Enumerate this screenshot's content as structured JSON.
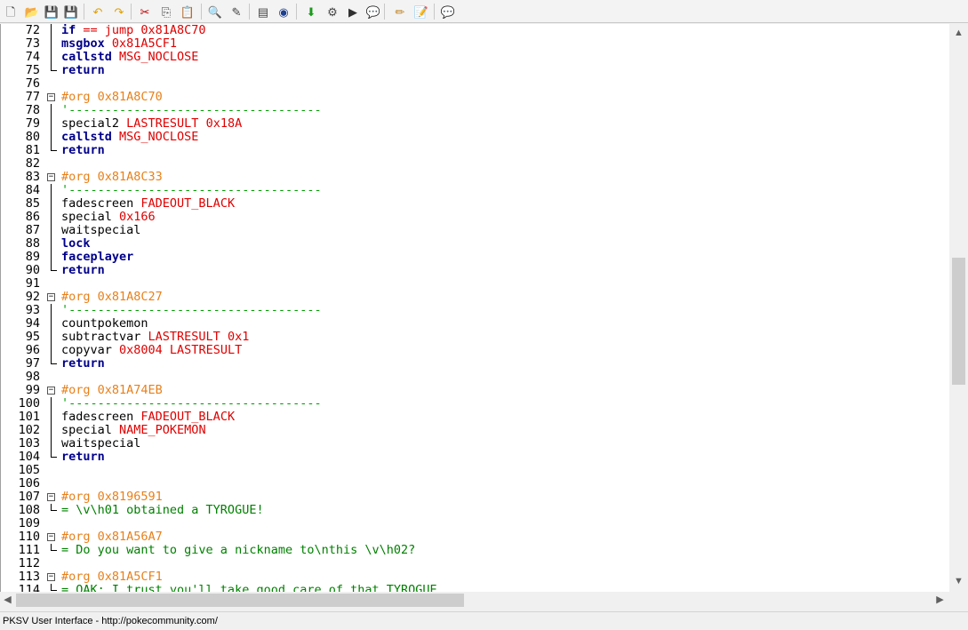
{
  "toolbar": {
    "buttons": [
      {
        "name": "new-file-icon",
        "glyph": "🗋"
      },
      {
        "name": "open-file-icon",
        "glyph": "📂"
      },
      {
        "name": "save-icon",
        "glyph": "💾"
      },
      {
        "name": "save-as-icon",
        "glyph": "💾"
      },
      {
        "name": "undo-icon",
        "glyph": "↶"
      },
      {
        "name": "redo-icon",
        "glyph": "↷"
      },
      {
        "name": "cut-icon",
        "glyph": "✂"
      },
      {
        "name": "copy-icon",
        "glyph": "⎘"
      },
      {
        "name": "paste-icon",
        "glyph": "📋"
      },
      {
        "name": "find-icon",
        "glyph": "🔍"
      },
      {
        "name": "replace-icon",
        "glyph": "✎"
      },
      {
        "name": "rom-document-icon",
        "glyph": "▤"
      },
      {
        "name": "globe-icon",
        "glyph": "◉"
      },
      {
        "name": "compile-icon",
        "glyph": "⬇"
      },
      {
        "name": "settings-icon",
        "glyph": "⚙"
      },
      {
        "name": "run-icon",
        "glyph": "▶"
      },
      {
        "name": "chat-icon",
        "glyph": "💬"
      },
      {
        "name": "edit-pencil-icon",
        "glyph": "✏"
      },
      {
        "name": "notes-icon",
        "glyph": "📝"
      },
      {
        "name": "help-chat-icon",
        "glyph": "💬"
      }
    ]
  },
  "editor": {
    "lines": [
      {
        "n": "72",
        "parts": [
          [
            "kw",
            "if"
          ],
          [
            "arg",
            " == jump 0x81A8C70"
          ]
        ],
        "gutter": "bar"
      },
      {
        "n": "73",
        "parts": [
          [
            "kw",
            "msgbox"
          ],
          [
            "arg",
            " 0x81A5CF1"
          ]
        ],
        "gutter": "bar"
      },
      {
        "n": "74",
        "parts": [
          [
            "kw",
            "callstd"
          ],
          [
            "arg",
            " MSG_NOCLOSE"
          ]
        ],
        "gutter": "bar"
      },
      {
        "n": "75",
        "parts": [
          [
            "kw",
            "return"
          ]
        ],
        "gutter": "end"
      },
      {
        "n": "76",
        "parts": [],
        "gutter": ""
      },
      {
        "n": "77",
        "parts": [
          [
            "org",
            "#org 0x81A8C70"
          ]
        ],
        "gutter": "fold"
      },
      {
        "n": "78",
        "parts": [
          [
            "cmt",
            "'-----------------------------------"
          ]
        ],
        "gutter": "bar"
      },
      {
        "n": "79",
        "parts": [
          [
            "cmd",
            "special2"
          ],
          [
            "arg",
            " LASTRESULT 0x18A"
          ]
        ],
        "gutter": "bar"
      },
      {
        "n": "80",
        "parts": [
          [
            "kw",
            "callstd"
          ],
          [
            "arg",
            " MSG_NOCLOSE"
          ]
        ],
        "gutter": "bar"
      },
      {
        "n": "81",
        "parts": [
          [
            "kw",
            "return"
          ]
        ],
        "gutter": "end"
      },
      {
        "n": "82",
        "parts": [],
        "gutter": ""
      },
      {
        "n": "83",
        "parts": [
          [
            "org",
            "#org 0x81A8C33"
          ]
        ],
        "gutter": "fold"
      },
      {
        "n": "84",
        "parts": [
          [
            "cmt",
            "'-----------------------------------"
          ]
        ],
        "gutter": "bar"
      },
      {
        "n": "85",
        "parts": [
          [
            "cmd",
            "fadescreen"
          ],
          [
            "arg",
            " FADEOUT_BLACK"
          ]
        ],
        "gutter": "bar"
      },
      {
        "n": "86",
        "parts": [
          [
            "cmd",
            "special"
          ],
          [
            "arg",
            " 0x166"
          ]
        ],
        "gutter": "bar"
      },
      {
        "n": "87",
        "parts": [
          [
            "cmd",
            "waitspecial"
          ]
        ],
        "gutter": "bar"
      },
      {
        "n": "88",
        "parts": [
          [
            "kw",
            "lock"
          ]
        ],
        "gutter": "bar"
      },
      {
        "n": "89",
        "parts": [
          [
            "kw",
            "faceplayer"
          ]
        ],
        "gutter": "bar"
      },
      {
        "n": "90",
        "parts": [
          [
            "kw",
            "return"
          ]
        ],
        "gutter": "end"
      },
      {
        "n": "91",
        "parts": [],
        "gutter": ""
      },
      {
        "n": "92",
        "parts": [
          [
            "org",
            "#org 0x81A8C27"
          ]
        ],
        "gutter": "fold"
      },
      {
        "n": "93",
        "parts": [
          [
            "cmt",
            "'-----------------------------------"
          ]
        ],
        "gutter": "bar"
      },
      {
        "n": "94",
        "parts": [
          [
            "cmd",
            "countpokemon"
          ]
        ],
        "gutter": "bar"
      },
      {
        "n": "95",
        "parts": [
          [
            "cmd",
            "subtractvar"
          ],
          [
            "arg",
            " LASTRESULT 0x1"
          ]
        ],
        "gutter": "bar"
      },
      {
        "n": "96",
        "parts": [
          [
            "cmd",
            "copyvar"
          ],
          [
            "arg",
            " 0x8004 LASTRESULT"
          ]
        ],
        "gutter": "bar"
      },
      {
        "n": "97",
        "parts": [
          [
            "kw",
            "return"
          ]
        ],
        "gutter": "end"
      },
      {
        "n": "98",
        "parts": [],
        "gutter": ""
      },
      {
        "n": "99",
        "parts": [
          [
            "org",
            "#org 0x81A74EB"
          ]
        ],
        "gutter": "fold"
      },
      {
        "n": "100",
        "parts": [
          [
            "cmt",
            "'-----------------------------------"
          ]
        ],
        "gutter": "bar"
      },
      {
        "n": "101",
        "parts": [
          [
            "cmd",
            "fadescreen"
          ],
          [
            "arg",
            " FADEOUT_BLACK"
          ]
        ],
        "gutter": "bar"
      },
      {
        "n": "102",
        "parts": [
          [
            "cmd",
            "special"
          ],
          [
            "arg",
            " NAME_POKEMON"
          ]
        ],
        "gutter": "bar"
      },
      {
        "n": "103",
        "parts": [
          [
            "cmd",
            "waitspecial"
          ]
        ],
        "gutter": "bar"
      },
      {
        "n": "104",
        "parts": [
          [
            "kw",
            "return"
          ]
        ],
        "gutter": "end"
      },
      {
        "n": "105",
        "parts": [],
        "gutter": ""
      },
      {
        "n": "106",
        "parts": [],
        "gutter": ""
      },
      {
        "n": "107",
        "parts": [
          [
            "org",
            "#org 0x8196591"
          ]
        ],
        "gutter": "fold"
      },
      {
        "n": "108",
        "parts": [
          [
            "str",
            "= \\v\\h01 obtained a TYROGUE!"
          ]
        ],
        "gutter": "end"
      },
      {
        "n": "109",
        "parts": [],
        "gutter": ""
      },
      {
        "n": "110",
        "parts": [
          [
            "org",
            "#org 0x81A56A7"
          ]
        ],
        "gutter": "fold"
      },
      {
        "n": "111",
        "parts": [
          [
            "str",
            "= Do you want to give a nickname to\\nthis \\v\\h02?"
          ]
        ],
        "gutter": "end"
      },
      {
        "n": "112",
        "parts": [],
        "gutter": ""
      },
      {
        "n": "113",
        "parts": [
          [
            "org",
            "#org 0x81A5CF1"
          ]
        ],
        "gutter": "fold"
      },
      {
        "n": "114",
        "parts": [
          [
            "str",
            "= OAK: I trust you'll take good care of that TYROGUE"
          ]
        ],
        "gutter": "end"
      }
    ]
  },
  "scroll": {
    "up": "▲",
    "down": "▼",
    "left": "◀",
    "right": "▶"
  },
  "status": {
    "text": "PKSV User Interface - http://pokecommunity.com/"
  }
}
